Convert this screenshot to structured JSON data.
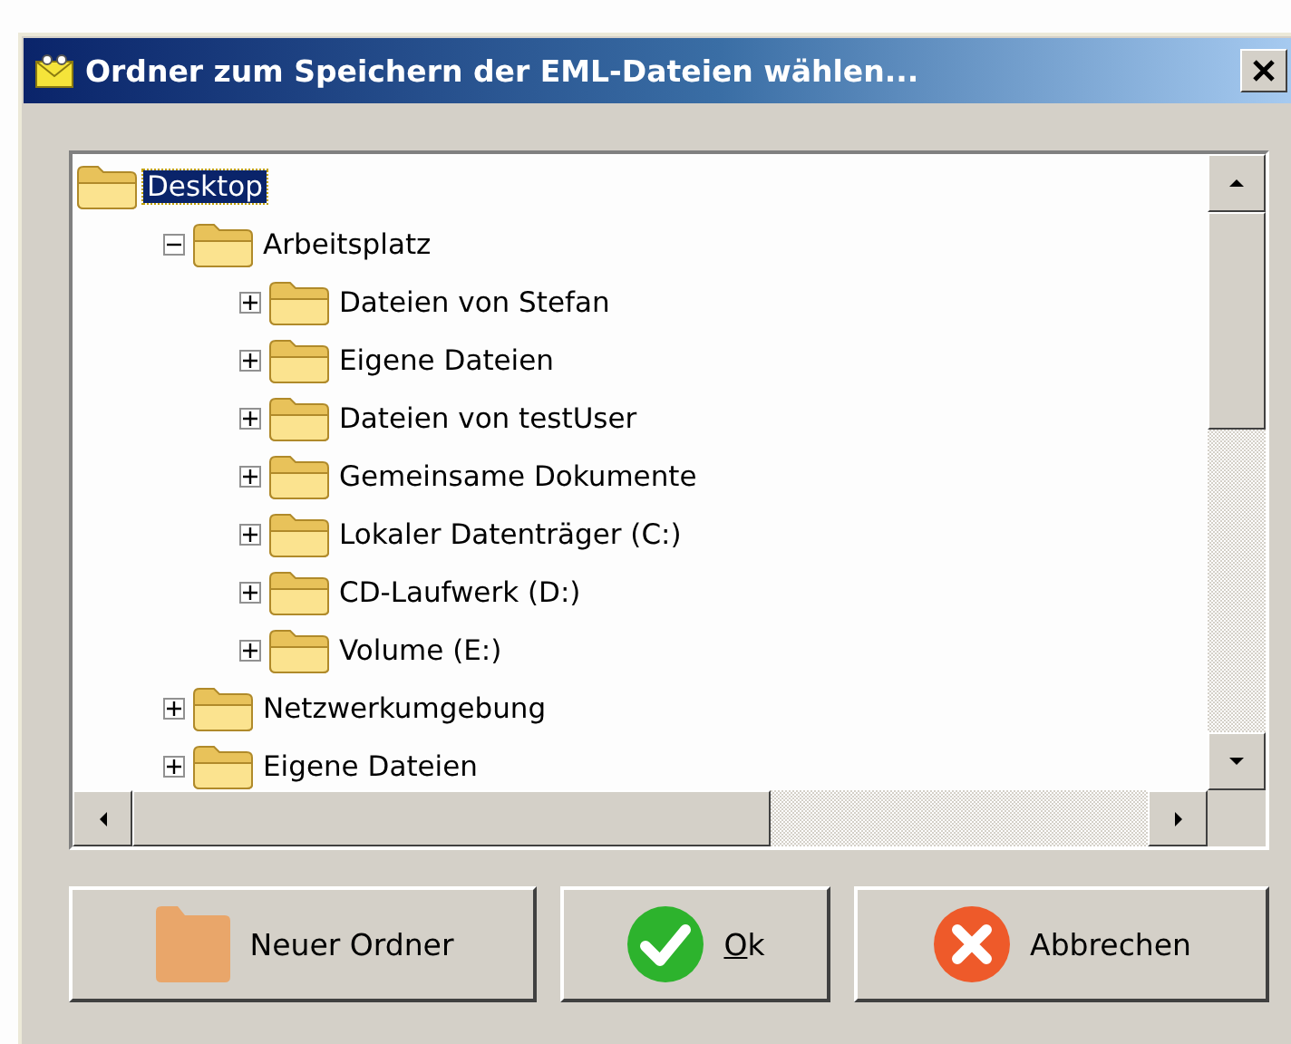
{
  "window": {
    "title": "Ordner zum Speichern der EML-Dateien wählen..."
  },
  "tree": [
    {
      "label": "Desktop",
      "selected": true,
      "children": [
        {
          "label": "Arbeitsplatz",
          "selected": false,
          "expanded": true,
          "children": [
            {
              "label": "Dateien von Stefan",
              "selected": false,
              "expanded": false
            },
            {
              "label": "Eigene Dateien",
              "selected": false,
              "expanded": false
            },
            {
              "label": "Dateien von testUser",
              "selected": false,
              "expanded": false
            },
            {
              "label": "Gemeinsame Dokumente",
              "selected": false,
              "expanded": false
            },
            {
              "label": "Lokaler Datenträger (C:)",
              "selected": false,
              "expanded": false
            },
            {
              "label": "CD-Laufwerk (D:)",
              "selected": false,
              "expanded": false
            },
            {
              "label": "Volume (E:)",
              "selected": false,
              "expanded": false
            }
          ]
        },
        {
          "label": "Netzwerkumgebung",
          "selected": false,
          "expanded": false
        },
        {
          "label": "Eigene Dateien",
          "selected": false,
          "expanded": false
        }
      ]
    }
  ],
  "buttons": [
    {
      "kind": "new-folder",
      "label": "Neuer Ordner",
      "access_key_underlined": false
    },
    {
      "kind": "ok",
      "label": "Ok",
      "access_key_underlined": true
    },
    {
      "kind": "cancel",
      "label": "Abbrechen",
      "access_key_underlined": false
    }
  ]
}
